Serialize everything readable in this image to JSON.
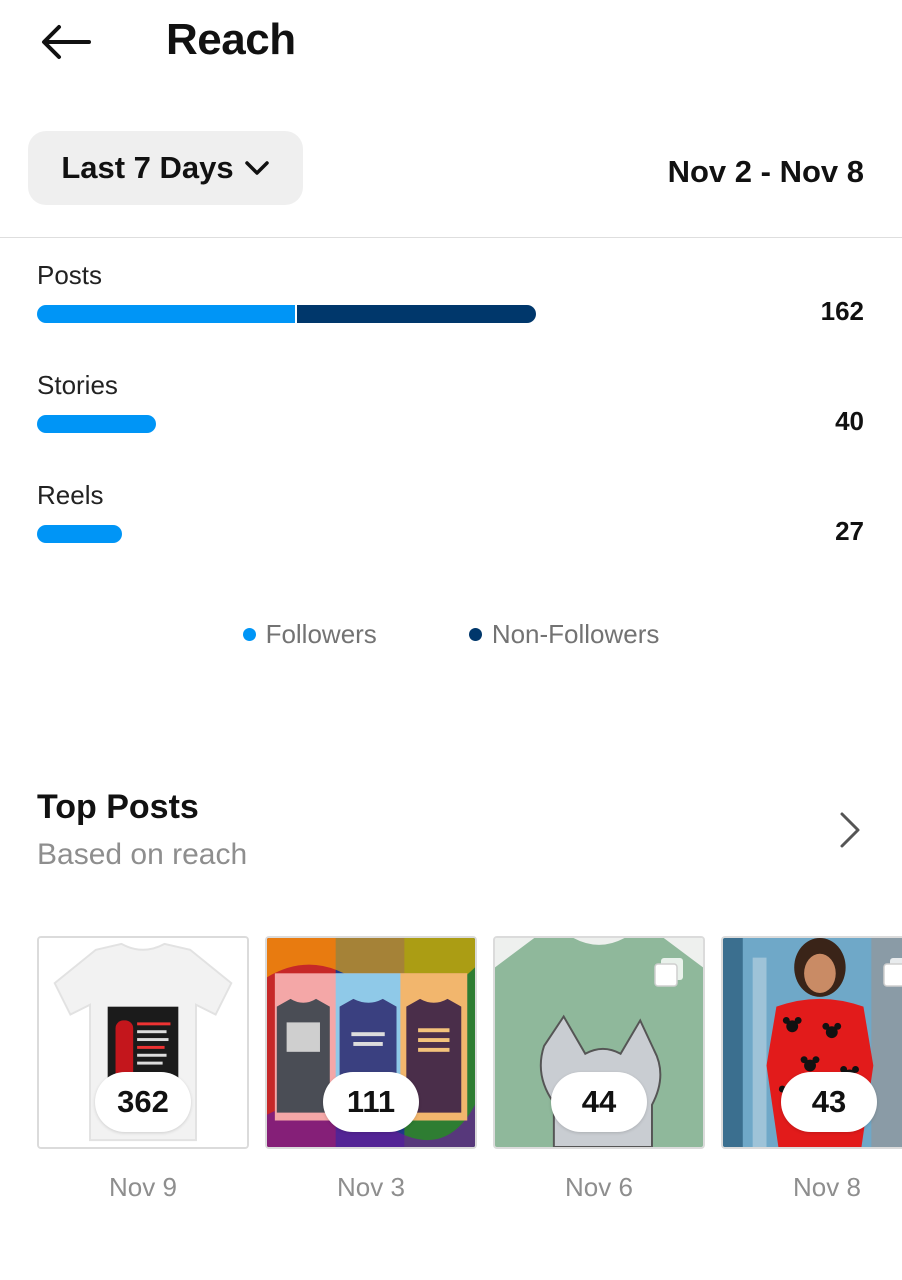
{
  "header": {
    "title": "Reach"
  },
  "filter": {
    "range_label": "Last 7 Days",
    "date_range": "Nov 2 - Nov 8"
  },
  "colors": {
    "followers": "#0095f6",
    "non_followers": "#00376b"
  },
  "reach_breakdown": [
    {
      "label": "Posts",
      "value": "162",
      "followers_fraction": 0.52,
      "non_followers_fraction": 0.48
    },
    {
      "label": "Stories",
      "value": "40",
      "followers_fraction": 1.0,
      "non_followers_fraction": 0.0
    },
    {
      "label": "Reels",
      "value": "27",
      "followers_fraction": 1.0,
      "non_followers_fraction": 0.0
    }
  ],
  "legend": {
    "followers": "Followers",
    "non_followers": "Non-Followers"
  },
  "top_posts": {
    "title": "Top Posts",
    "subtitle": "Based on reach",
    "items": [
      {
        "count": "362",
        "date": "Nov 9",
        "thumbnail": "white-tshirt-money-heist-print"
      },
      {
        "count": "111",
        "date": "Nov 3",
        "thumbnail": "three-tshirts-colorful-background"
      },
      {
        "count": "44",
        "date": "Nov 6",
        "thumbnail": "green-tshirt-tom-cat-print"
      },
      {
        "count": "43",
        "date": "Nov 8",
        "thumbnail": "woman-red-mickey-dress"
      }
    ]
  }
}
